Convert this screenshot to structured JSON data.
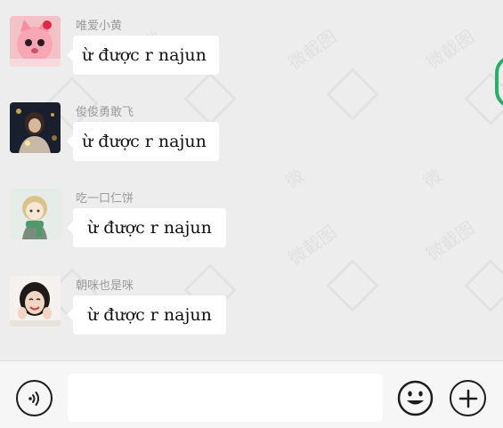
{
  "chat": {
    "messages": [
      {
        "sender": "唯爱小黄",
        "text": "ừ được r najun",
        "avatar": "pink-cat-avatar"
      },
      {
        "sender": "俊俊勇敢飞",
        "text": "ừ được r najun",
        "avatar": "night-girl-avatar"
      },
      {
        "sender": "吃一口仁饼",
        "text": "ừ được r najun",
        "avatar": "anime-scarf-avatar"
      },
      {
        "sender": "朝咪也是咪",
        "text": "ừ được r najun",
        "avatar": "smiling-girl-avatar"
      }
    ]
  },
  "input_bar": {
    "voice_icon": "voice-icon",
    "message_value": "",
    "emoji_icon": "emoji-icon",
    "plus_icon": "plus-icon"
  },
  "colors": {
    "background": "#ededed",
    "bubble": "#ffffff",
    "sender_name": "#9a9a9a",
    "accent_green": "#2aae67",
    "input_bar": "#f6f6f6"
  }
}
